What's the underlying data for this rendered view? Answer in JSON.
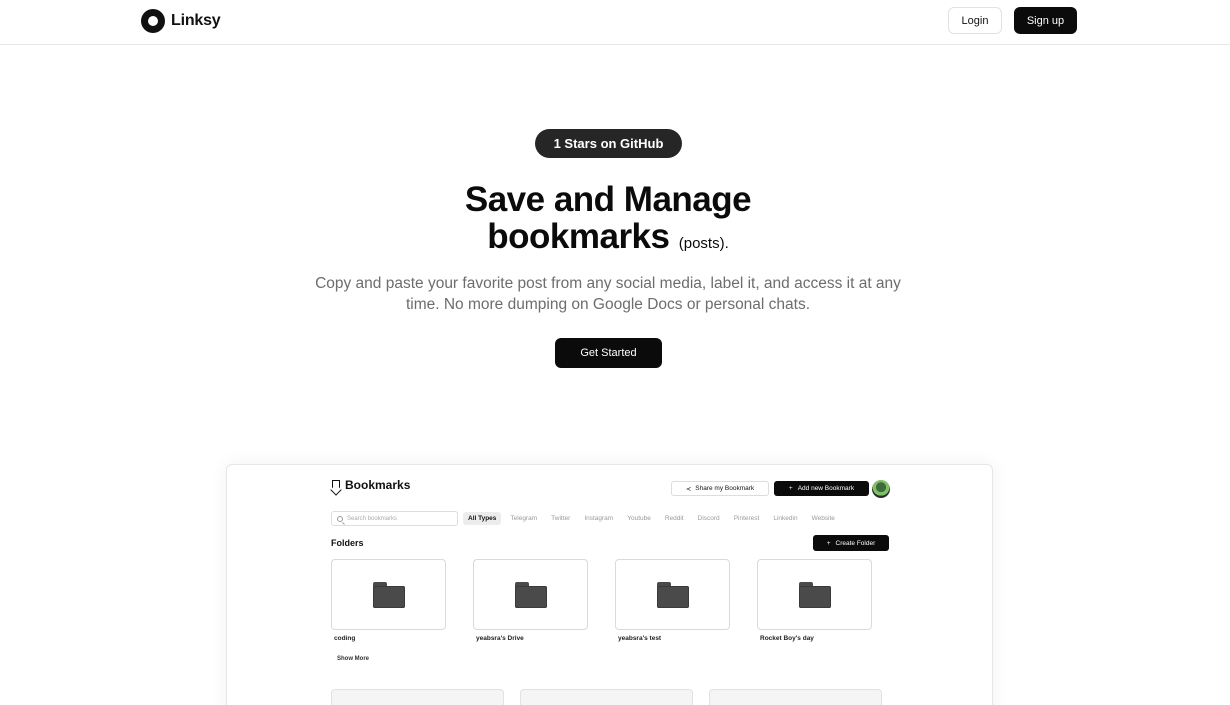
{
  "nav": {
    "brand": "Linksy",
    "login": "Login",
    "signup": "Sign up"
  },
  "hero": {
    "stars_badge": "1 Stars on GitHub",
    "title_line1": "Save and Manage",
    "title_line2": "bookmarks",
    "title_aside": "(posts).",
    "subtitle": "Copy and paste your favorite post from any social media, label it, and access it at any time. No more dumping on Google Docs or personal chats.",
    "cta": "Get Started"
  },
  "preview": {
    "title": "Bookmarks",
    "share_button": "Share my Bookmark",
    "add_button": "Add new Bookmark",
    "search_placeholder": "Search bookmarks",
    "filters": [
      "All Types",
      "Telegram",
      "Twitter",
      "Instagram",
      "Youtube",
      "Reddit",
      "Discord",
      "Pinterest",
      "Linkedin",
      "Website"
    ],
    "active_filter": "All Types",
    "folders_label": "Folders",
    "create_folder": "Create Folder",
    "folders": [
      "coding",
      "yeabsra's Drive",
      "yeabsra's test",
      "Rocket Boy's day"
    ],
    "show_more": "Show More"
  },
  "colors": {
    "primary": "#0b0b0b",
    "badge": "#262626",
    "muted_text": "#6d6d6d",
    "border": "#e6e6e6"
  }
}
